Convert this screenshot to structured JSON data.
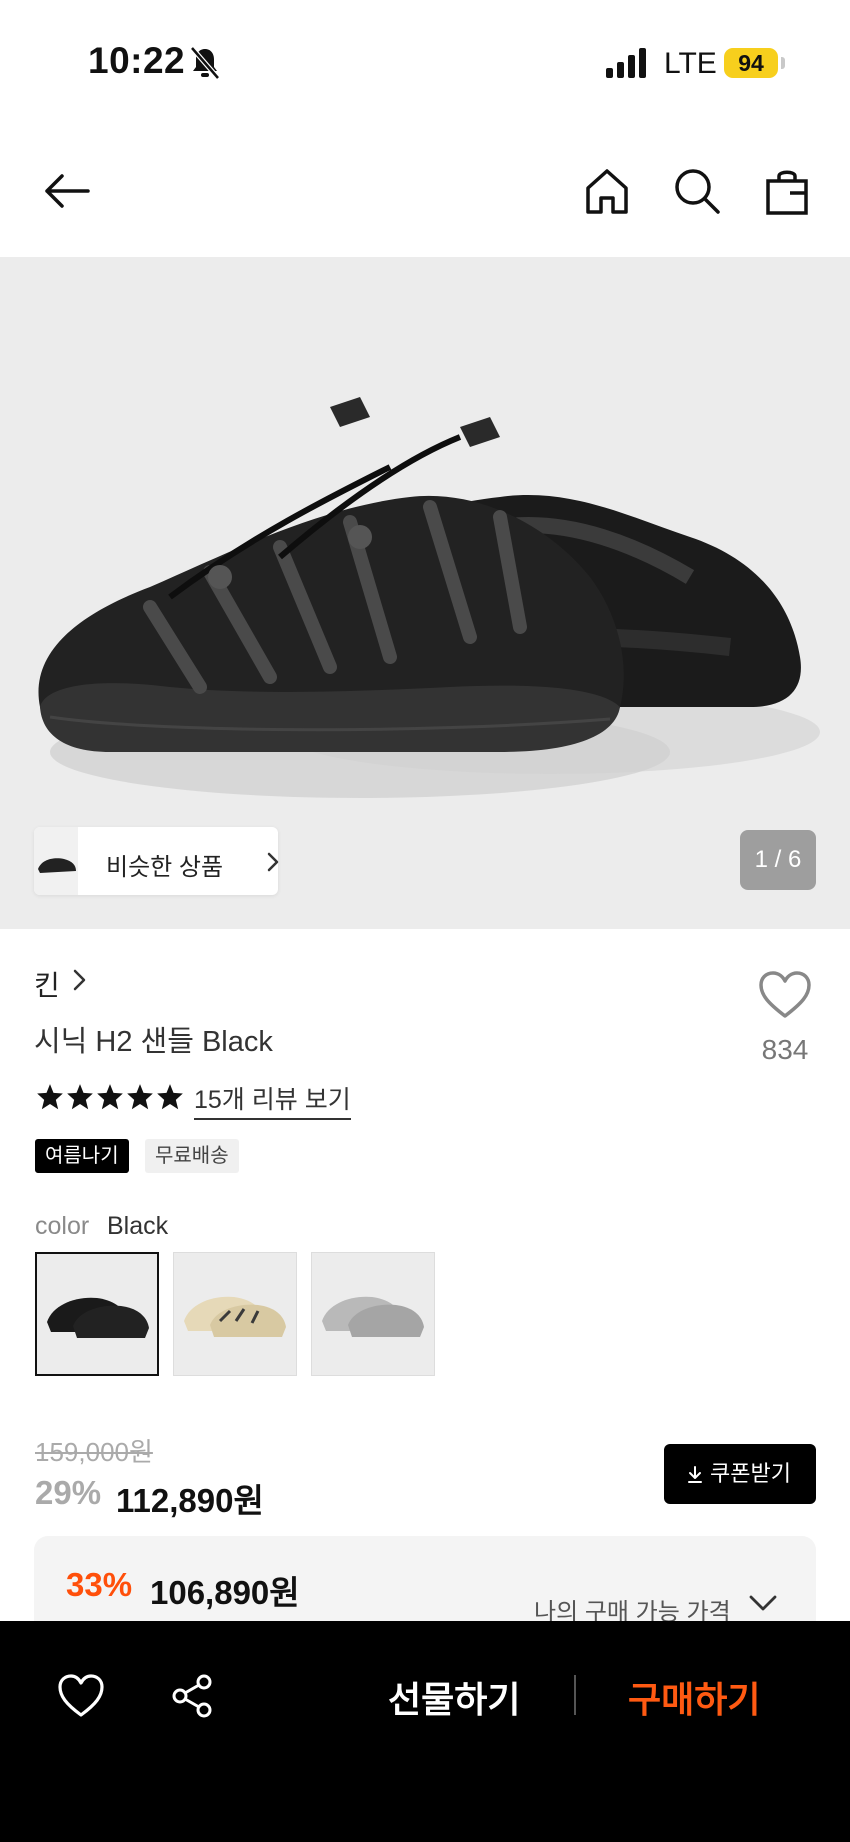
{
  "status_bar": {
    "time": "10:22",
    "network": "LTE",
    "battery": "94",
    "icons": [
      "bell-muted-icon",
      "signal-icon"
    ]
  },
  "nav": {
    "icons": [
      "back-arrow-icon",
      "home-icon",
      "search-icon",
      "shopping-bag-icon"
    ]
  },
  "gallery": {
    "similar_label": "비슷한 상품",
    "counter": "1 / 6"
  },
  "product": {
    "brand": "킨",
    "name": "시닉 H2 샌들 Black",
    "like_count": "834",
    "rating": 5,
    "review_link": "15개 리뷰 보기",
    "tags": [
      "여름나기",
      "무료배송"
    ]
  },
  "color": {
    "label": "color",
    "selected": "Black",
    "options": [
      {
        "name": "Black",
        "color": "#1a1a1a"
      },
      {
        "name": "Beige",
        "color": "#e6d9b8"
      },
      {
        "name": "Grey",
        "color": "#b9b9b9"
      }
    ]
  },
  "price": {
    "original": "159,000원",
    "discount": "29%",
    "sale": "112,890원",
    "coupon_label": "쿠폰받기",
    "best_discount": "33%",
    "best_price": "106,890원",
    "best_label": "나의 구매 가능 가격"
  },
  "bottom_bar": {
    "gift_label": "선물하기",
    "buy_label": "구매하기",
    "buy_color": "#ff5a12"
  }
}
